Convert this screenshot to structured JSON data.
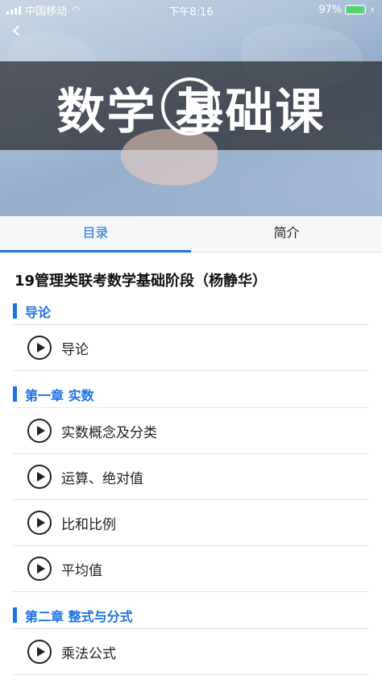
{
  "status_bar": {
    "carrier": "中国移动",
    "time": "下午8:16",
    "battery": "97%",
    "battery_fill": 0.97,
    "battery_color": "#4cd964"
  },
  "banner": {
    "title": "数学 基础课",
    "play_icon": "play-circle-icon",
    "back_icon": "back-chevron-icon"
  },
  "tabs": [
    {
      "label": "目录",
      "active": true
    },
    {
      "label": "简介",
      "active": false
    }
  ],
  "accent_color": "#1a73e8",
  "course_title": "19管理类联考数学基础阶段（杨静华）",
  "chapters": [
    {
      "title": "导论",
      "lessons": [
        "导论"
      ]
    },
    {
      "title": "第一章 实数",
      "lessons": [
        "实数概念及分类",
        "运算、绝对值",
        "比和比例",
        "平均值"
      ]
    },
    {
      "title": "第二章 整式与分式",
      "lessons": [
        "乘法公式"
      ]
    }
  ]
}
